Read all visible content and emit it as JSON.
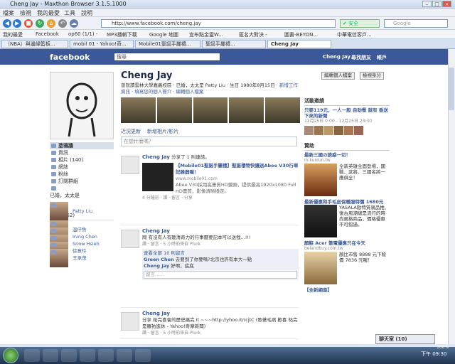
{
  "window": {
    "title": "Cheng Jay - Maxthon Browser 3.1.5.1000"
  },
  "menu": [
    "檔案",
    "檢視",
    "我的最愛",
    "工具",
    "說明"
  ],
  "address": {
    "url": "http://www.facebook.com/cheng.jay",
    "safe": "安全",
    "search_placeholder": "Google"
  },
  "favorites": [
    "我的最愛",
    "Facebook",
    "op60 (1/1) -",
    "MP3播輯下載",
    "Google 地圖",
    "宣布點金靈W...",
    "匿名大對決 -",
    "圖書-BEYON...",
    "中華電信客戶..."
  ],
  "tabs": [
    {
      "label": "（NBA）與邊緣籃板..."
    },
    {
      "label": "mobil 01 - Yahoo!奇..."
    },
    {
      "label": "Mobile01聖誕手麗禮..."
    },
    {
      "label": "聖誕手麗禮..."
    },
    {
      "label": "Cheng Jay",
      "active": true
    }
  ],
  "fb": {
    "logo": "facebook",
    "search": "搜尋",
    "nav": [
      "Cheng Jay",
      "尋找朋友",
      "帳戶"
    ],
    "profile": {
      "name": "Cheng Jay",
      "info1": "曾就讀雲林大學嘉義校區",
      "info2": "已婚，太太是 Patty Liu",
      "info3": "生日 1980年8月15日",
      "info4": "新增工作資訊",
      "info5": "填寫您的個人簡介",
      "info6": "編輯個人檔案",
      "edit_btn": "編輯個人檔案",
      "view_btn": "檢視身分"
    },
    "composer": {
      "tab1": "近況更新",
      "tab2": "新增相片/影片",
      "placeholder": "在想什麼嗎？"
    },
    "leftnav": [
      {
        "label": "塗鴉牆",
        "sel": true
      },
      {
        "label": "資訊"
      },
      {
        "label": "相片 (140)"
      },
      {
        "label": "網誌"
      },
      {
        "label": "粉絲"
      },
      {
        "label": "訂閱群組"
      }
    ],
    "married": "已婚，太太是",
    "spouse": "Patty Liu",
    "friends_title": "朋友 (162)",
    "friends": [
      "溫仔魚",
      "Ining Chen",
      "Snow Hsieh",
      "徐意玲",
      "王承茂"
    ],
    "posts": [
      {
        "name": "Cheng Jay",
        "action": "分享了 1 則連結。",
        "link": "【Mobile01聖誕手麗禮】聖誕禮物快讓送Abee V30行車記錄器喔！",
        "domain": "www.mobile01.com",
        "desc": "Abee V30採用高畫質HD鏡頭，提供最高1920x1080 Full HD畫質，影像清晰穩定。",
        "meta": "4 分鐘前 · 讚 · 留言 · 分享"
      },
      {
        "name": "Cheng Jay",
        "text": "問 有沒有人有聽清奇力的行事曆要記本可以送我...!!!",
        "meta": "讚 · 留言 · 5 小時前來自 Plurk",
        "c_head": "查看全部 10 則留言",
        "c1_name": "Green Chen",
        "c1_text": "去要到了你要嗎?北京也許有本大一點",
        "c2_name": "Cheng Jay",
        "c2_text": "好啊，底底",
        "c_placeholder": "留言……"
      },
      {
        "name": "Cheng Jay",
        "text": "分享 祐完喜會的歷史痛完 it ~~~http://yhoo.it/rcjtC (歌著毛病 歡喜 祐完是羅祐進休 - Yahoo!奇摩新聞)",
        "meta": "讚 · 留言 · 5 小時前來自 Plurk"
      }
    ],
    "right": {
      "events_title": "活動邀請",
      "event_title": "只要119元，一人一般 自助餐 就有 香送下來的新聞",
      "event_date": "12月25日 0:00 - 12月25日 23:30",
      "sponsor_title": "贊助",
      "ad1_title": "最新三國の誘惑一切！",
      "ad1_url": "in.kunlun.tw",
      "ad1_text": "全新英雄全面登場，國戰、武將、三國名將一應俱全！",
      "ad2_title": "最新優惠和手毛皮保暖服特價 1680元",
      "ad2_text": "YASALA歐特質親品推、復古風潮總是流行的時尚風格商品，價格優惠不可錯過。",
      "ad3_title": "顏粧 Acer 筆電優惠只在今天",
      "ad3_url": "belandbuy.com.tw",
      "ad3_text": "顏比市售 8888 元下殺價 7836 元喔！",
      "ad4_title": "【全新網遊】",
      "chat": "聊天室 (10)"
    }
  },
  "taskbar": {
    "time": "下午 09:30",
    "zoom": "100%"
  }
}
